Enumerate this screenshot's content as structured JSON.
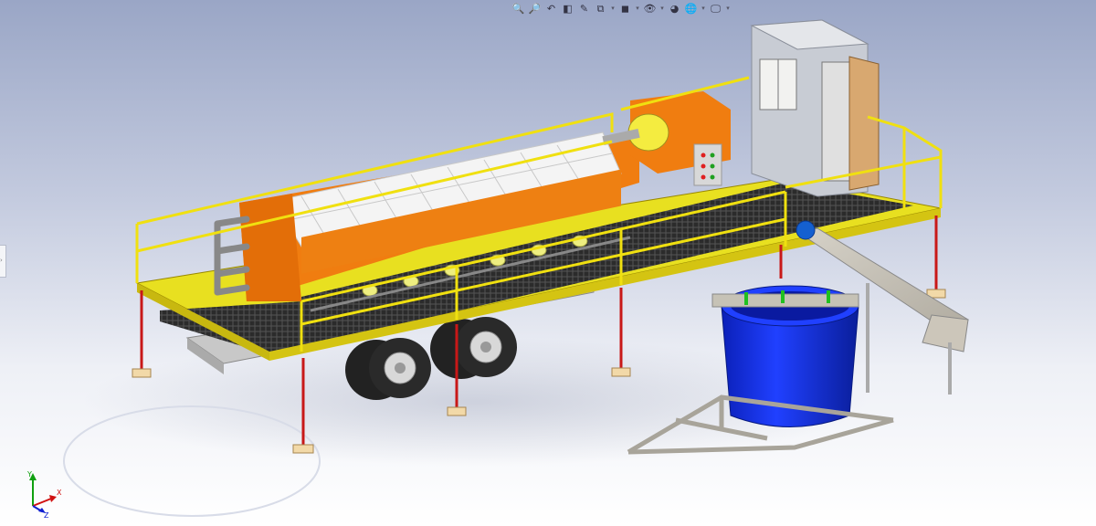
{
  "window": {
    "app": "SolidWorks",
    "view": "isometric assembly viewport"
  },
  "toolbar": {
    "buttons": [
      {
        "name": "zoom-to-fit-icon",
        "glyph": "🔍"
      },
      {
        "name": "zoom-to-area-icon",
        "glyph": "🔎"
      },
      {
        "name": "previous-view-icon",
        "glyph": "↶"
      },
      {
        "name": "section-view-icon",
        "glyph": "◧"
      },
      {
        "name": "dynamic-annotation-icon",
        "glyph": "✎"
      },
      {
        "name": "view-orientation-icon",
        "glyph": "⧉"
      },
      {
        "name": "display-style-icon",
        "glyph": "◼"
      },
      {
        "name": "hide-show-items-icon",
        "glyph": "👁"
      },
      {
        "name": "edit-appearance-icon",
        "glyph": "◕"
      },
      {
        "name": "apply-scene-icon",
        "glyph": "🌐"
      },
      {
        "name": "view-settings-icon",
        "glyph": "🖵"
      }
    ]
  },
  "triad": {
    "x_label": "X",
    "y_label": "Y",
    "z_label": "Z"
  },
  "colors": {
    "frame_orange": "#f07d10",
    "railing_yellow": "#f0e010",
    "tank_blue": "#1030e0",
    "leg_red": "#c81818",
    "grating": "#2a2a2a",
    "cabin_grey": "#c8ccd4"
  },
  "left_handle": {
    "glyph": "›"
  }
}
